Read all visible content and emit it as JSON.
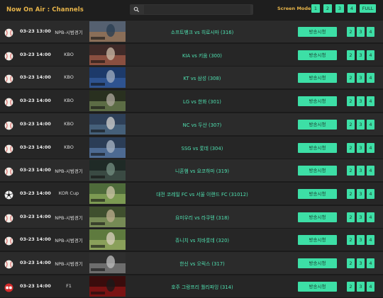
{
  "header": {
    "title": "Now On Air : Channels",
    "search_placeholder": "",
    "screen_mode_label": "Screen Mode :",
    "screen_modes": [
      "1",
      "2",
      "3",
      "4",
      "FULL"
    ],
    "search_icon": "search-icon"
  },
  "colors": {
    "accent": "#3ddfa6",
    "title": "#e8b54a",
    "match_text": "#4fe0b0"
  },
  "rows": [
    {
      "icon": "baseball-icon",
      "time": "03-23 13:00",
      "league": "NPB-시범경기",
      "match": "소프트뱅크 vs 히로시마 (316)",
      "watch": "방송시청",
      "modes": [
        "2",
        "3",
        "4"
      ]
    },
    {
      "icon": "baseball-icon",
      "time": "03-23 14:00",
      "league": "KBO",
      "match": "KIA vs 키움 (300)",
      "watch": "방송시청",
      "modes": [
        "2",
        "3",
        "4"
      ]
    },
    {
      "icon": "baseball-icon",
      "time": "03-23 14:00",
      "league": "KBO",
      "match": "KT vs 삼성 (308)",
      "watch": "방송시청",
      "modes": [
        "2",
        "3",
        "4"
      ]
    },
    {
      "icon": "baseball-icon",
      "time": "03-23 14:00",
      "league": "KBO",
      "match": "LG vs 한화 (301)",
      "watch": "방송시청",
      "modes": [
        "2",
        "3",
        "4"
      ]
    },
    {
      "icon": "baseball-icon",
      "time": "03-23 14:00",
      "league": "KBO",
      "match": "NC vs 두산 (307)",
      "watch": "방송시청",
      "modes": [
        "2",
        "3",
        "4"
      ]
    },
    {
      "icon": "baseball-icon",
      "time": "03-23 14:00",
      "league": "KBO",
      "match": "SSG vs 롯데 (304)",
      "watch": "방송시청",
      "modes": [
        "2",
        "3",
        "4"
      ]
    },
    {
      "icon": "baseball-icon",
      "time": "03-23 14:00",
      "league": "NPB-시범경기",
      "match": "니혼햄 vs 요코하마 (319)",
      "watch": "방송시청",
      "modes": [
        "2",
        "3",
        "4"
      ]
    },
    {
      "icon": "soccer-ball-icon",
      "time": "03-23 14:00",
      "league": "KOR Cup",
      "match": "대전 코레일 FC vs 서울 이랜드 FC (31012)",
      "watch": "방송시청",
      "modes": [
        "2",
        "3",
        "4"
      ]
    },
    {
      "icon": "baseball-icon",
      "time": "03-23 14:00",
      "league": "NPB-시범경기",
      "match": "요미우리 vs 라쿠텐 (318)",
      "watch": "방송시청",
      "modes": [
        "2",
        "3",
        "4"
      ]
    },
    {
      "icon": "baseball-icon",
      "time": "03-23 14:00",
      "league": "NPB-시범경기",
      "match": "쥬니치 vs 치바롯데 (320)",
      "watch": "방송시청",
      "modes": [
        "2",
        "3",
        "4"
      ]
    },
    {
      "icon": "baseball-icon",
      "time": "03-23 14:00",
      "league": "NPB-시범경기",
      "match": "한신 vs 오릭스 (317)",
      "watch": "방송시청",
      "modes": [
        "2",
        "3",
        "4"
      ]
    },
    {
      "icon": "f1-icon",
      "time": "03-23 14:00",
      "league": "F1",
      "match": "호주 그랑프리 퀄리파잉 (314)",
      "watch": "방송시청",
      "modes": [
        "2",
        "3",
        "4"
      ]
    }
  ]
}
